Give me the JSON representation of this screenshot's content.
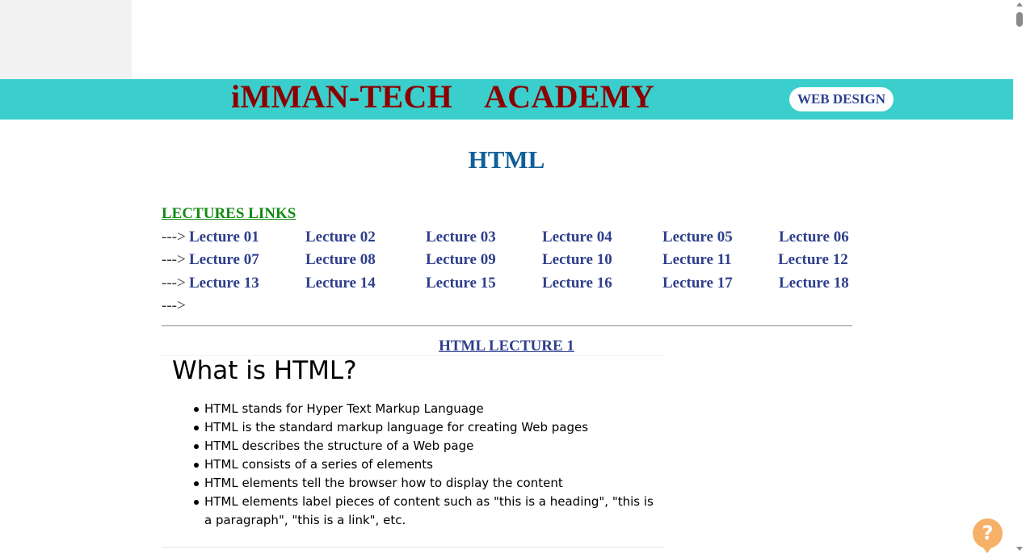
{
  "header": {
    "title": "iMMAN-TECH    ACADEMY",
    "pill_label": "WEB DESIGN"
  },
  "main": {
    "heading": "HTML",
    "lectures_title": "LECTURES LINKS",
    "arrow": "--->",
    "lecture_rows": [
      [
        "Lecture 01",
        "Lecture 02",
        "Lecture 03",
        "Lecture 04",
        "Lecture 05",
        "Lecture 06"
      ],
      [
        "Lecture 07",
        "Lecture 08",
        "Lecture 09",
        "Lecture 10",
        "Lecture 11",
        "Lecture 12"
      ],
      [
        "Lecture 13",
        "Lecture 14",
        "Lecture 15",
        "Lecture 16",
        "Lecture 17",
        "Lecture 18"
      ]
    ],
    "lecture_heading": "HTML LECTURE 1",
    "content": {
      "title": "What is HTML?",
      "bullets": [
        "HTML stands for Hyper Text Markup Language",
        "HTML is the standard markup language for creating Web pages",
        "HTML describes the structure of a Web page",
        "HTML consists of a series of elements",
        "HTML elements tell the browser how to display the content",
        "HTML elements label pieces of content such as \"this is a heading\", \"this is a paragraph\", \"this is a link\", etc."
      ]
    }
  },
  "help": {
    "label": "?"
  },
  "colors": {
    "header_bar": "#3acfcc",
    "title": "#8b0000",
    "link": "#2f3f8c",
    "heading": "#0f5f98",
    "lectures_title": "#128a12",
    "help_button": "#f7b068"
  },
  "icons": {
    "scroll_up": "chevron-up-icon",
    "scroll_down": "chevron-down-icon",
    "help": "help-icon"
  }
}
